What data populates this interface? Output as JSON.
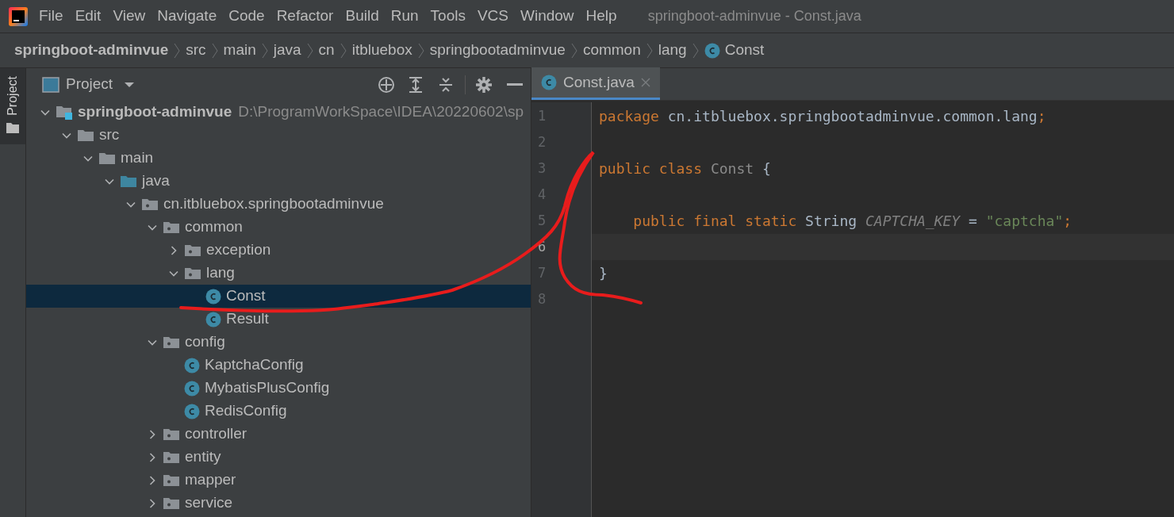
{
  "menu_bar": {
    "items": [
      "File",
      "Edit",
      "View",
      "Navigate",
      "Code",
      "Refactor",
      "Build",
      "Run",
      "Tools",
      "VCS",
      "Window",
      "Help"
    ],
    "title": "springboot-adminvue - Const.java"
  },
  "breadcrumb": [
    {
      "label": "springboot-adminvue",
      "kind": "project"
    },
    {
      "label": "src",
      "kind": "folder"
    },
    {
      "label": "main",
      "kind": "folder"
    },
    {
      "label": "java",
      "kind": "folder"
    },
    {
      "label": "cn",
      "kind": "folder"
    },
    {
      "label": "itbluebox",
      "kind": "folder"
    },
    {
      "label": "springbootadminvue",
      "kind": "folder"
    },
    {
      "label": "common",
      "kind": "folder"
    },
    {
      "label": "lang",
      "kind": "folder"
    },
    {
      "label": "Const",
      "kind": "class"
    }
  ],
  "side_strip": {
    "label": "Project"
  },
  "project_panel": {
    "title": "Project",
    "tree": [
      {
        "label": "springboot-adminvue",
        "path": "D:\\ProgramWorkSpace\\IDEA\\20220602\\sp",
        "kind": "project",
        "expanded": true,
        "selected": false,
        "children": [
          {
            "label": "src",
            "kind": "folder",
            "expanded": true,
            "selected": false,
            "children": [
              {
                "label": "main",
                "kind": "folder",
                "expanded": true,
                "selected": false,
                "children": [
                  {
                    "label": "java",
                    "kind": "source",
                    "expanded": true,
                    "selected": false,
                    "children": [
                      {
                        "label": "cn.itbluebox.springbootadminvue",
                        "kind": "package",
                        "expanded": true,
                        "selected": false,
                        "children": [
                          {
                            "label": "common",
                            "kind": "package",
                            "expanded": true,
                            "selected": false,
                            "children": [
                              {
                                "label": "exception",
                                "kind": "package",
                                "expanded": false,
                                "selected": false
                              },
                              {
                                "label": "lang",
                                "kind": "package",
                                "expanded": true,
                                "selected": false,
                                "children": [
                                  {
                                    "label": "Const",
                                    "kind": "class",
                                    "selected": true
                                  },
                                  {
                                    "label": "Result",
                                    "kind": "class",
                                    "selected": false
                                  }
                                ]
                              }
                            ]
                          },
                          {
                            "label": "config",
                            "kind": "package",
                            "expanded": true,
                            "selected": false,
                            "children": [
                              {
                                "label": "KaptchaConfig",
                                "kind": "class",
                                "selected": false
                              },
                              {
                                "label": "MybatisPlusConfig",
                                "kind": "class",
                                "selected": false
                              },
                              {
                                "label": "RedisConfig",
                                "kind": "class",
                                "selected": false
                              }
                            ]
                          },
                          {
                            "label": "controller",
                            "kind": "package",
                            "expanded": false,
                            "selected": false
                          },
                          {
                            "label": "entity",
                            "kind": "package",
                            "expanded": false,
                            "selected": false
                          },
                          {
                            "label": "mapper",
                            "kind": "package",
                            "expanded": false,
                            "selected": false
                          },
                          {
                            "label": "service",
                            "kind": "package",
                            "expanded": false,
                            "selected": false
                          }
                        ]
                      }
                    ]
                  }
                ]
              }
            ]
          }
        ]
      }
    ]
  },
  "editor": {
    "tabs": [
      {
        "label": "Const.java",
        "selected": true
      }
    ],
    "lines": [
      {
        "number": "1",
        "current": false,
        "tokens": [
          {
            "text": "package",
            "kind": "keyword"
          },
          {
            "text": " cn.itbluebox.springbootadminvue.common.lang",
            "kind": "plain"
          },
          {
            "text": ";",
            "kind": "keyword"
          }
        ]
      },
      {
        "number": "2",
        "current": false
      },
      {
        "number": "3",
        "current": false,
        "tokens": [
          {
            "text": "public class",
            "kind": "keyword"
          },
          {
            "text": " Const",
            "kind": "unused"
          },
          {
            "text": " {",
            "kind": "plain"
          }
        ]
      },
      {
        "number": "4",
        "current": false
      },
      {
        "number": "5",
        "current": false,
        "tokens": [
          {
            "text": "    public final static",
            "kind": "keyword"
          },
          {
            "text": " String ",
            "kind": "plain"
          },
          {
            "text": "CAPTCHA_KEY",
            "kind": "constant"
          },
          {
            "text": " = ",
            "kind": "plain"
          },
          {
            "text": "\"captcha\"",
            "kind": "string"
          },
          {
            "text": ";",
            "kind": "keyword"
          }
        ]
      },
      {
        "number": "6",
        "current": true
      },
      {
        "number": "7",
        "current": false,
        "tokens": [
          {
            "text": "}",
            "kind": "plain"
          }
        ]
      },
      {
        "number": "8",
        "current": false
      }
    ]
  }
}
